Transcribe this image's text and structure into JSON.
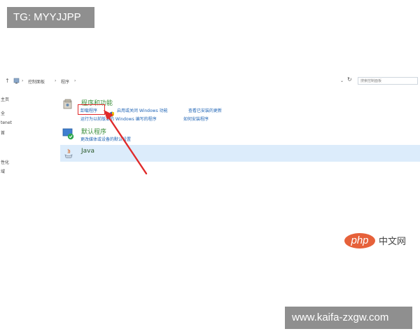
{
  "watermarks": {
    "top": "TG: MYYJJPP",
    "bottom": "www.kaifa-zxgw.com"
  },
  "navbar": {
    "back_icon": "up-arrow-icon",
    "breadcrumb": [
      "控制面板",
      "程序"
    ],
    "search_placeholder": "搜索控制面板"
  },
  "sidebar": {
    "items": [
      "主页",
      "全",
      "tenet",
      "首",
      "性化",
      "域"
    ]
  },
  "programs": {
    "title": "程序和功能",
    "links": [
      "卸载程序",
      "启用或关闭 Windows 功能",
      "查看已安装的更新",
      "运行为以前版本的 Windows 编写的程序",
      "如何安装程序"
    ]
  },
  "default_programs": {
    "title": "默认程序",
    "links": [
      "更改媒体或设备的默认设置"
    ]
  },
  "java": {
    "title": "Java"
  },
  "logo": {
    "brand": "php",
    "cn": "中文网"
  },
  "colors": {
    "highlight": "#e02a2a",
    "link": "#1e63b5",
    "category": "#3c8f3c",
    "selected_row": "#dcecfb"
  }
}
